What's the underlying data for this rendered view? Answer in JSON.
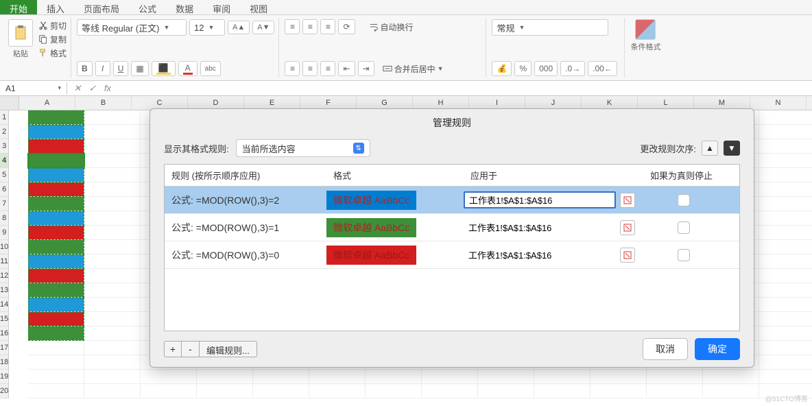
{
  "tabs": [
    "开始",
    "插入",
    "页面布局",
    "公式",
    "数据",
    "审阅",
    "视图"
  ],
  "clipboard": {
    "cut": "剪切",
    "copy": "复制",
    "format": "格式",
    "paste": "粘贴"
  },
  "font": {
    "name": "等线 Regular (正文)",
    "size": "12",
    "bold": "B",
    "italic": "I",
    "underline": "U"
  },
  "alignment": {
    "wrap": "自动换行",
    "merge": "合并后居中"
  },
  "number": {
    "format": "常规"
  },
  "cf": {
    "label": "条件格式"
  },
  "name_box": "A1",
  "columns": [
    "A",
    "B",
    "C",
    "D",
    "E",
    "F",
    "G",
    "H",
    "I",
    "J",
    "K",
    "L",
    "M",
    "N"
  ],
  "rows": 20,
  "selected_row": 4,
  "row_colors": {
    "1": "#3e8f3a",
    "2": "#1f99d7",
    "3": "#d31f1f",
    "4": "#3e8f3a",
    "5": "#1f99d7",
    "6": "#d31f1f",
    "7": "#3e8f3a",
    "8": "#1f99d7",
    "9": "#d31f1f",
    "10": "#3e8f3a",
    "11": "#1f99d7",
    "12": "#d31f1f",
    "13": "#3e8f3a",
    "14": "#1f99d7",
    "15": "#d31f1f",
    "16": "#3e8f3a"
  },
  "dialog": {
    "title": "管理规则",
    "show_rules_label": "显示其格式规则:",
    "scope": "当前所选内容",
    "order_label": "更改规则次序:",
    "headers": {
      "rule": "规则 (按所示顺序应用)",
      "format": "格式",
      "applies": "应用于",
      "stop": "如果为真则停止"
    },
    "preview_text": "微软卓越 AaBbCc",
    "rules": [
      {
        "formula": "公式: =MOD(ROW(),3)=2",
        "fmt": "blue",
        "applies": "工作表1!$A$1:$A$16",
        "selected": true
      },
      {
        "formula": "公式: =MOD(ROW(),3)=1",
        "fmt": "green",
        "applies": "工作表1!$A$1:$A$16",
        "selected": false
      },
      {
        "formula": "公式: =MOD(ROW(),3)=0",
        "fmt": "red",
        "applies": "工作表1!$A$1:$A$16",
        "selected": false
      }
    ],
    "add": "+",
    "remove": "-",
    "edit": "编辑规则...",
    "cancel": "取消",
    "ok": "确定"
  },
  "watermark": "@51CTO博客"
}
